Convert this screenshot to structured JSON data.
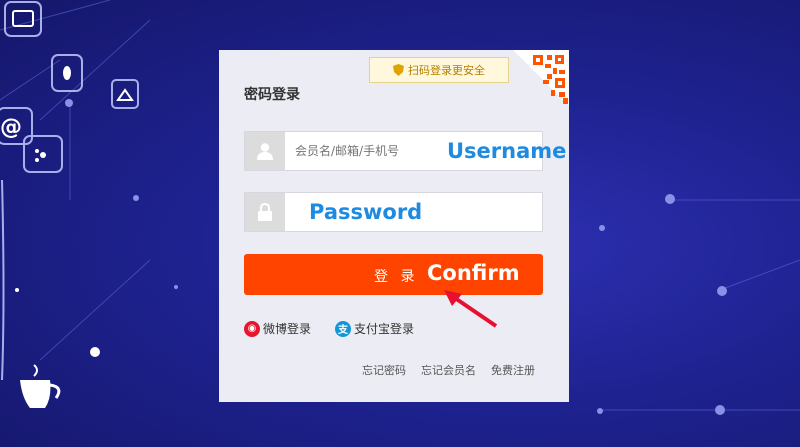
{
  "login": {
    "title": "密码登录",
    "qr_tip": "扫码登录更安全",
    "username_placeholder": "会员名/邮箱/手机号",
    "username_annotation": "Username",
    "password_annotation": "Password",
    "submit_label": "登 录",
    "submit_annotation": "Confirm",
    "alt_logins": [
      {
        "label": "微博登录",
        "icon": "weibo-icon",
        "color": "#e6162d"
      },
      {
        "label": "支付宝登录",
        "icon": "alipay-icon",
        "color": "#1296db"
      }
    ],
    "bottom_links": [
      "忘记密码",
      "忘记会员名",
      "免费注册"
    ]
  },
  "colors": {
    "accent": "#ff4400",
    "annotation": "#1e8be0",
    "arrow": "#e8102e"
  }
}
